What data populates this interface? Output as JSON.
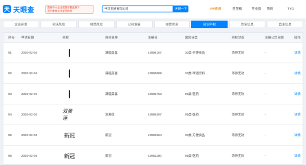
{
  "header": {
    "logo_mark": "天",
    "logo_text": "天眼查",
    "promo_line1": "国家中小企业发展子基金旗下",
    "promo_line2": "官方备案企业征信机构",
    "search_value": "中汉金质食料公司",
    "search_button": "天眼一下",
    "vip": "VIP会员",
    "enterprise": "百宝箱",
    "app": "专业版",
    "login": "我的",
    "user": "TYO"
  },
  "tabs": [
    {
      "label": "企业背景",
      "active": false
    },
    {
      "label": "司法风险",
      "active": false
    },
    {
      "label": "经营风险",
      "active": false
    },
    {
      "label": "公司发展",
      "active": false
    },
    {
      "label": "经营状况",
      "active": false
    },
    {
      "label": "知识产权",
      "active": true
    },
    {
      "label": "历史信息",
      "active": false
    },
    {
      "label": "自主信息",
      "active": false
    }
  ],
  "table": {
    "headers": [
      "序号",
      "申请日期",
      "商标",
      "商标名称",
      "注册号",
      "国际分类",
      "商标状态",
      "注册公告日期",
      "操作"
    ],
    "rows": [
      {
        "index": "91",
        "date": "2020-02-04",
        "mark_style": "bar",
        "mark_text": "",
        "name": "满喵美喜",
        "reg_no": "43994167",
        "category": "30类-方便食品",
        "status": "等待无效",
        "pub_date": "-",
        "action": "详情"
      },
      {
        "index": "92",
        "date": "2020-02-04",
        "mark_style": "bar",
        "mark_text": "",
        "name": "满喵美喜",
        "reg_no": "43993088",
        "category": "33类-啤酒饮料",
        "status": "等待无效",
        "pub_date": "-",
        "action": "详情"
      },
      {
        "index": "93",
        "date": "2020-02-04",
        "mark_style": "bar",
        "mark_text": "",
        "name": "满喵美喜",
        "reg_no": "43995753",
        "category": "05类-医药",
        "status": "等待无效",
        "pub_date": "-",
        "action": "详情"
      },
      {
        "index": "94",
        "date": "2020-02-03",
        "mark_style": "cal",
        "mark_text": "双黄莲",
        "name": "双黄莲",
        "reg_no": "43986397",
        "category": "05类-医药",
        "status": "等待无效",
        "pub_date": "-",
        "action": "详情"
      },
      {
        "index": "95",
        "date": "2020-02-03",
        "mark_style": "serif",
        "mark_text": "新冠",
        "name": "新冠",
        "reg_no": "43993364",
        "category": "30类-方便食品",
        "status": "等待无效",
        "pub_date": "-",
        "action": "详情"
      },
      {
        "index": "96",
        "date": "2020-02-03",
        "mark_style": "serif",
        "mark_text": "新冠",
        "name": "新冠",
        "reg_no": "43961180",
        "category": "05类-医药",
        "status": "等待无效",
        "pub_date": "-",
        "action": "详情"
      }
    ]
  }
}
